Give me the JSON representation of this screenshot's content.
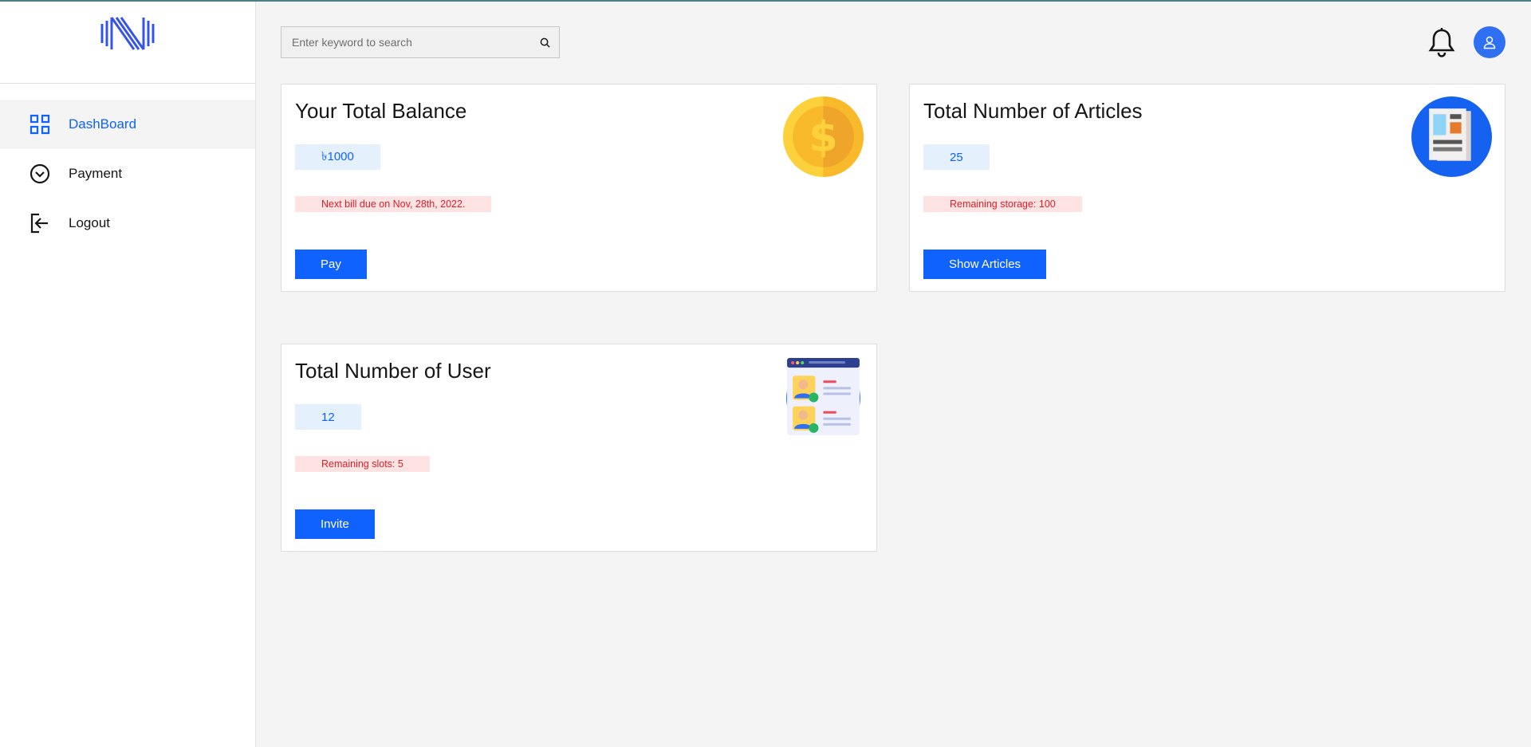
{
  "colors": {
    "accent": "#0f62fe",
    "sidebar_bg": "#ffffff",
    "page_bg": "#f4f4f4",
    "value_tag_bg": "#e5f0fd",
    "note_tag_bg": "#ffe3e3",
    "note_text": "#da1e28"
  },
  "sidebar": {
    "logo_icon": "logo-icon",
    "items": [
      {
        "label": "DashBoard",
        "icon": "grid-icon",
        "active": true
      },
      {
        "label": "Payment",
        "icon": "chevron-circle-icon",
        "active": false
      },
      {
        "label": "Logout",
        "icon": "logout-icon",
        "active": false
      }
    ]
  },
  "header": {
    "search_placeholder": "Enter keyword to search",
    "search_value": "",
    "notification_icon": "bell-icon",
    "user_icon": "user-icon"
  },
  "cards": {
    "balance": {
      "title": "Your Total Balance",
      "value": "৳1000",
      "note": "Next bill due on Nov, 28th, 2022.",
      "button": "Pay",
      "image_icon": "dollar-coin-icon"
    },
    "articles": {
      "title": "Total Number of Articles",
      "value": "25",
      "note": "Remaining storage: 100",
      "button": "Show Articles",
      "image_icon": "newspaper-icon"
    },
    "users": {
      "title": "Total Number of User",
      "value": "12",
      "note": "Remaining slots: 5",
      "button": "Invite",
      "image_icon": "user-profiles-icon"
    }
  }
}
